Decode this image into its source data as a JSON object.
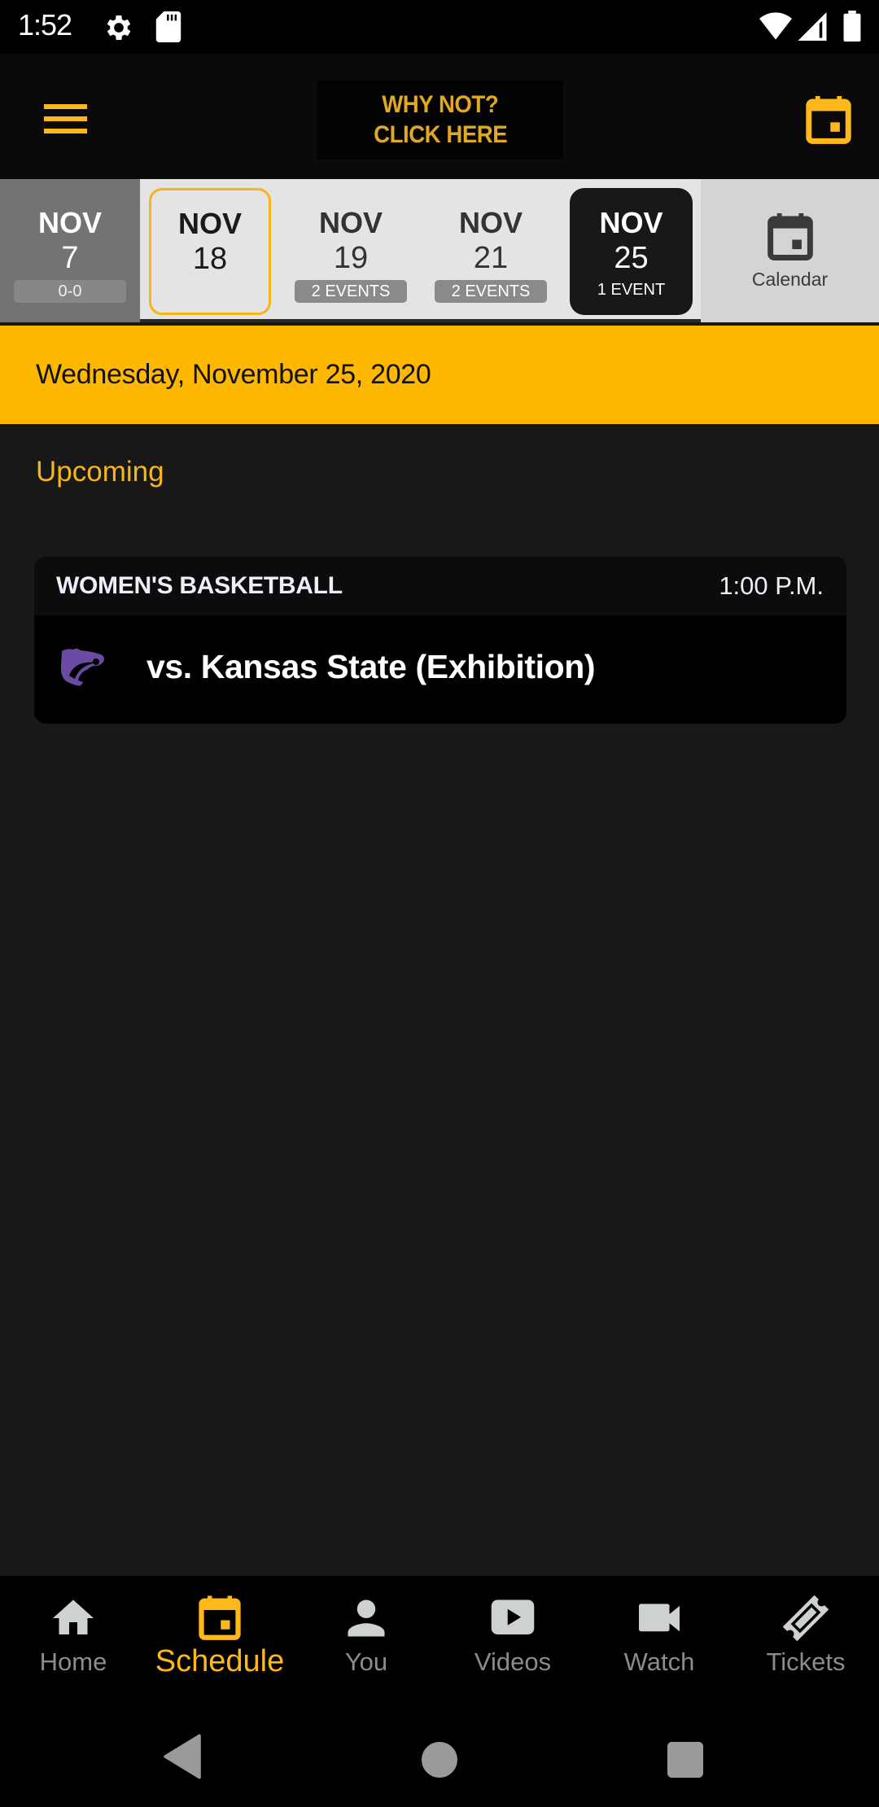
{
  "status_bar": {
    "time": "1:52",
    "icons": [
      "gear-icon",
      "sd-card-icon",
      "wifi-icon",
      "signal-icon",
      "battery-icon"
    ]
  },
  "header": {
    "menu_icon": "hamburger-menu-icon",
    "promo_line1": "WHY NOT?",
    "promo_line2": "CLICK HERE",
    "calendar_icon": "calendar-icon",
    "accent_color": "#ffb81c"
  },
  "date_strip": {
    "items": [
      {
        "month": "NOV",
        "day": "7",
        "badge": "0-0",
        "state": "past"
      },
      {
        "month": "NOV",
        "day": "18",
        "badge": "",
        "state": "today"
      },
      {
        "month": "NOV",
        "day": "19",
        "badge": "2 EVENTS",
        "state": "normal"
      },
      {
        "month": "NOV",
        "day": "21",
        "badge": "2 EVENTS",
        "state": "normal"
      },
      {
        "month": "NOV",
        "day": "25",
        "badge": "1 EVENT",
        "state": "selected"
      }
    ],
    "calendar_label": "Calendar"
  },
  "selected_date": "Wednesday, November 25, 2020",
  "section_label": "Upcoming",
  "events": [
    {
      "sport": "WOMEN'S BASKETBALL",
      "time": "1:00 P.M.",
      "opponent_logo": "kansas-state-wildcat-logo",
      "title": "vs. Kansas State (Exhibition)"
    }
  ],
  "bottom_nav": {
    "items": [
      {
        "label": "Home",
        "icon": "home-icon",
        "active": false
      },
      {
        "label": "Schedule",
        "icon": "calendar-icon",
        "active": true
      },
      {
        "label": "You",
        "icon": "person-icon",
        "active": false
      },
      {
        "label": "Videos",
        "icon": "play-video-icon",
        "active": false
      },
      {
        "label": "Watch",
        "icon": "video-camera-icon",
        "active": false
      },
      {
        "label": "Tickets",
        "icon": "ticket-icon",
        "active": false
      }
    ]
  },
  "colors": {
    "accent": "#ffb81c",
    "date_header_bg": "#ffb800",
    "page_bg": "#181818",
    "card_bg": "#000000",
    "team_purple": "#6a4aa5"
  }
}
